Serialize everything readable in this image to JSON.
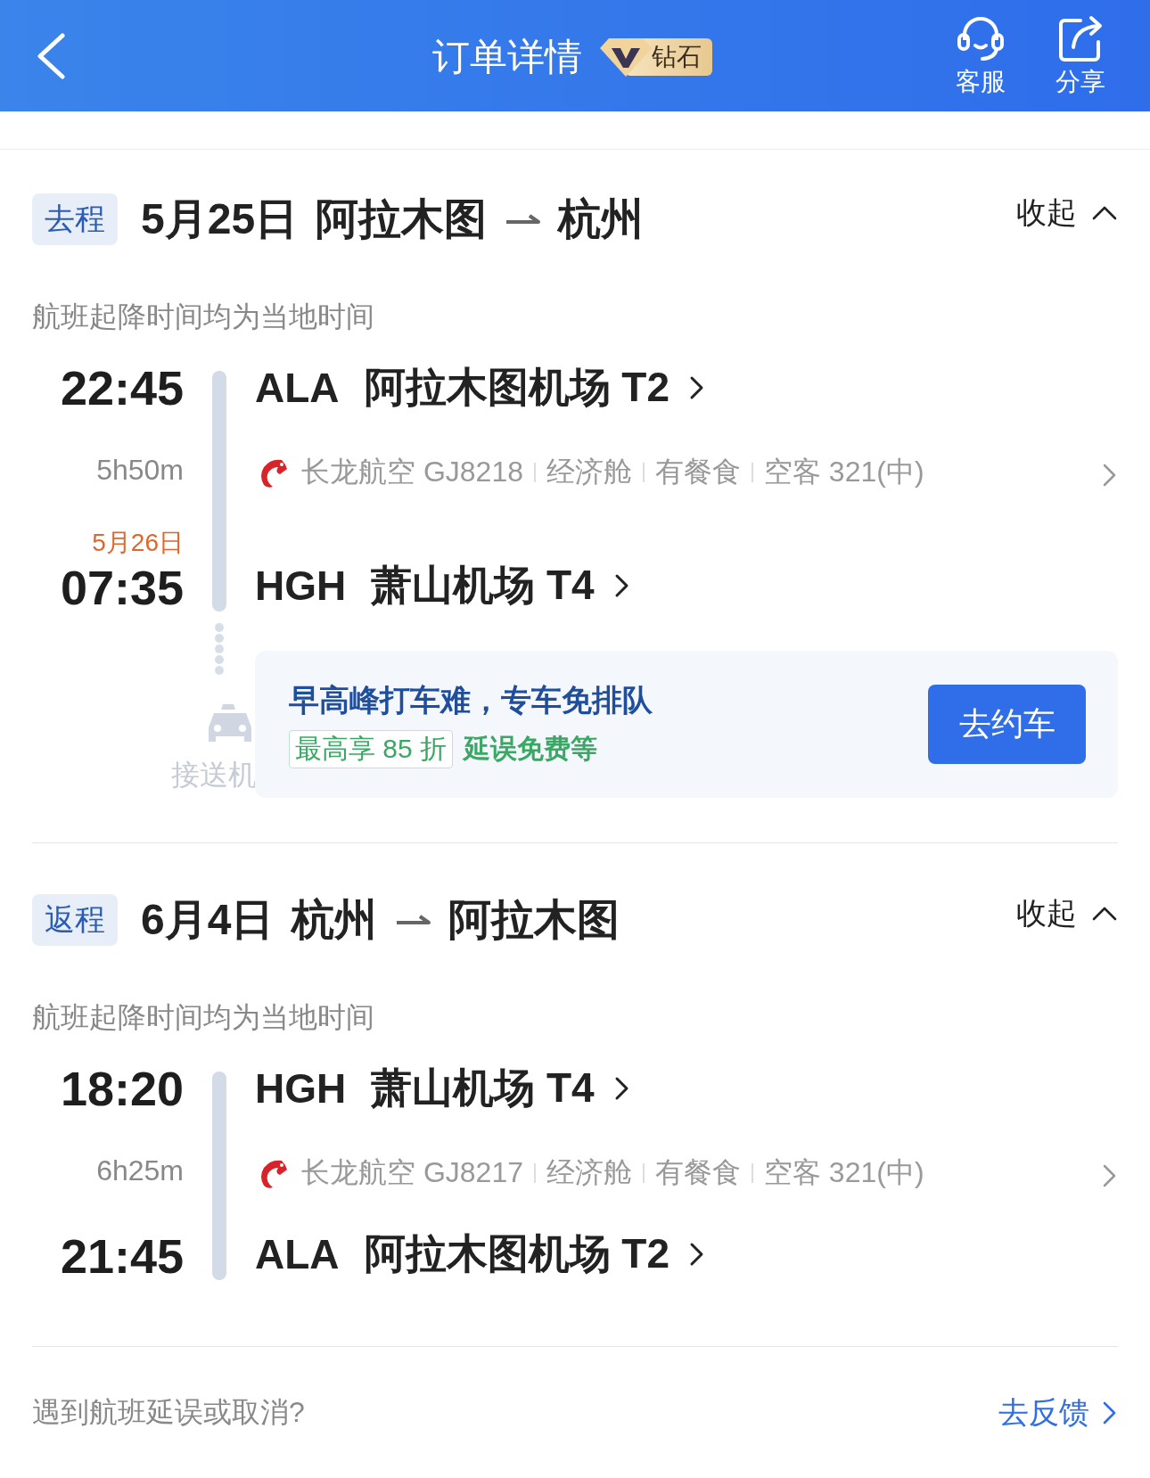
{
  "header": {
    "title": "订单详情",
    "badge": "钻石",
    "actions": [
      {
        "kind": "headset",
        "label": "客服"
      },
      {
        "kind": "share",
        "label": "分享"
      }
    ]
  },
  "segments": [
    {
      "tag": "去程",
      "date": "5月25日",
      "from": "阿拉木图",
      "to": "杭州",
      "toggle": "收起",
      "expanded": true,
      "note": "航班起降时间均为当地时间",
      "departure": {
        "time": "22:45",
        "code": "ALA",
        "airport": "阿拉木图机场 T2"
      },
      "duration": "5h50m",
      "flight": {
        "airline": "长龙航空",
        "number": "GJ8218",
        "details": [
          "经济舱",
          "有餐食",
          "空客 321(中)"
        ]
      },
      "arrival": {
        "date": "5月26日",
        "time": "07:35",
        "code": "HGH",
        "airport": "萧山机场 T4"
      },
      "transfer": {
        "label": "接送机",
        "headline": "早高峰打车难，专车免排队",
        "tags": [
          {
            "kind": "outlined",
            "text": "最高享 85 折"
          },
          {
            "kind": "plain",
            "text": "延误免费等"
          }
        ],
        "button": "去约车"
      }
    },
    {
      "tag": "返程",
      "date": "6月4日",
      "from": "杭州",
      "to": "阿拉木图",
      "toggle": "收起",
      "expanded": true,
      "note": "航班起降时间均为当地时间",
      "departure": {
        "time": "18:20",
        "code": "HGH",
        "airport": "萧山机场 T4"
      },
      "duration": "6h25m",
      "flight": {
        "airline": "长龙航空",
        "number": "GJ8217",
        "details": [
          "经济舱",
          "有餐食",
          "空客 321(中)"
        ]
      },
      "arrival": {
        "time": "21:45",
        "code": "ALA",
        "airport": "阿拉木图机场 T2"
      }
    }
  ],
  "footer": {
    "question": "遇到航班延误或取消?",
    "link": "去反馈"
  }
}
